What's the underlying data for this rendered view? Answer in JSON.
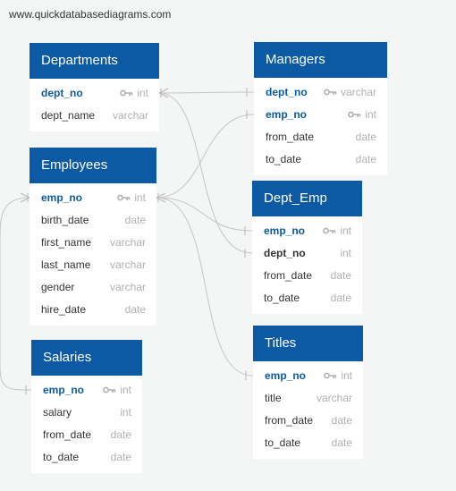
{
  "watermark": "www.quickdatabasediagrams.com",
  "tables": {
    "departments": {
      "title": "Departments",
      "fields": [
        {
          "name": "dept_no",
          "type": "int"
        },
        {
          "name": "dept_name",
          "type": "varchar"
        }
      ]
    },
    "employees": {
      "title": "Employees",
      "fields": [
        {
          "name": "emp_no",
          "type": "int"
        },
        {
          "name": "birth_date",
          "type": "date"
        },
        {
          "name": "first_name",
          "type": "varchar"
        },
        {
          "name": "last_name",
          "type": "varchar"
        },
        {
          "name": "gender",
          "type": "varchar"
        },
        {
          "name": "hire_date",
          "type": "date"
        }
      ]
    },
    "salaries": {
      "title": "Salaries",
      "fields": [
        {
          "name": "emp_no",
          "type": "int"
        },
        {
          "name": "salary",
          "type": "int"
        },
        {
          "name": "from_date",
          "type": "date"
        },
        {
          "name": "to_date",
          "type": "date"
        }
      ]
    },
    "managers": {
      "title": "Managers",
      "fields": [
        {
          "name": "dept_no",
          "type": "varchar"
        },
        {
          "name": "emp_no",
          "type": "int"
        },
        {
          "name": "from_date",
          "type": "date"
        },
        {
          "name": "to_date",
          "type": "date"
        }
      ]
    },
    "dept_emp": {
      "title": "Dept_Emp",
      "fields": [
        {
          "name": "emp_no",
          "type": "int"
        },
        {
          "name": "dept_no",
          "type": "int"
        },
        {
          "name": "from_date",
          "type": "date"
        },
        {
          "name": "to_date",
          "type": "date"
        }
      ]
    },
    "titles": {
      "title": "Titles",
      "fields": [
        {
          "name": "emp_no",
          "type": "int"
        },
        {
          "name": "title",
          "type": "varchar"
        },
        {
          "name": "from_date",
          "type": "date"
        },
        {
          "name": "to_date",
          "type": "date"
        }
      ]
    }
  },
  "colors": {
    "header": "#0c5aa4",
    "key_field": "#0c5aa4",
    "type_text": "#b0b0b0",
    "connector": "#c4c4c4",
    "background": "#f4f6f6"
  }
}
